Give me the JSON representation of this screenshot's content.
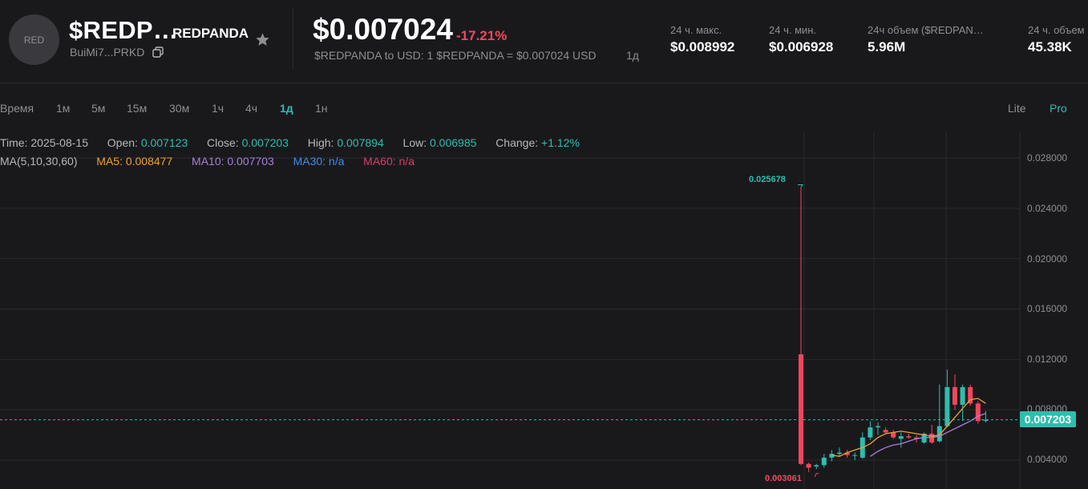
{
  "header": {
    "logo_text": "RED",
    "symbol": "$REDP…",
    "name": "REDPANDA",
    "address": "BuiMi7...PRKD",
    "price": "$0.007024",
    "change": "-17.21%",
    "conversion": "$REDPANDA to USD: 1 $REDPANDA = $0.007024 USD",
    "conversion_interval": "1д",
    "stats": [
      {
        "label": "24 ч. макс.",
        "value": "$0.008992"
      },
      {
        "label": "24 ч. мин.",
        "value": "$0.006928"
      },
      {
        "label": "24ч объем ($REDPAN…",
        "value": "5.96M"
      },
      {
        "label": "24 ч. объем",
        "value": "45.38K"
      }
    ]
  },
  "toolbar": {
    "intervals": [
      "Время",
      "1м",
      "5м",
      "15м",
      "30м",
      "1ч",
      "4ч",
      "1д",
      "1н"
    ],
    "active_interval": "1д",
    "modes": [
      "Lite",
      "Pro"
    ],
    "active_mode": "Pro"
  },
  "ohlc": {
    "time_label": "Time:",
    "time": "2025-08-15",
    "open_label": "Open:",
    "open": "0.007123",
    "close_label": "Close:",
    "close": "0.007203",
    "high_label": "High:",
    "high": "0.007894",
    "low_label": "Low:",
    "low": "0.006985",
    "change_label": "Change:",
    "change": "+1.12%"
  },
  "ma": {
    "label": "MA(5,10,30,60)",
    "ma5": "MA5: 0.008477",
    "ma10": "MA10: 0.007703",
    "ma30": "MA30: n/a",
    "ma60": "MA60: n/a"
  },
  "colors": {
    "up": "#2ebdae",
    "down": "#f6465d",
    "ma5": "#f0a030",
    "ma10": "#a97fd6",
    "ma30": "#3b8fe8",
    "ma60": "#e03a6a"
  },
  "chart_data": {
    "type": "candlestick",
    "y_ticks": [
      "0.028000",
      "0.024000",
      "0.020000",
      "0.016000",
      "0.012000",
      "0.008000",
      "0.004000"
    ],
    "current_price": "0.007203",
    "max_marker": "0.025678",
    "min_marker": "0.003061",
    "ylim": [
      0.0021,
      0.0307
    ],
    "candles": [
      {
        "o": 0.0124,
        "h": 0.02568,
        "l": 0.0036,
        "c": 0.0037
      },
      {
        "o": 0.0037,
        "h": 0.0038,
        "l": 0.00306,
        "c": 0.0034
      },
      {
        "o": 0.0035,
        "h": 0.0037,
        "l": 0.0033,
        "c": 0.0036
      },
      {
        "o": 0.0036,
        "h": 0.0045,
        "l": 0.0034,
        "c": 0.0042
      },
      {
        "o": 0.0042,
        "h": 0.0048,
        "l": 0.0039,
        "c": 0.0045
      },
      {
        "o": 0.0045,
        "h": 0.005,
        "l": 0.0043,
        "c": 0.0046
      },
      {
        "o": 0.0046,
        "h": 0.0048,
        "l": 0.0042,
        "c": 0.0044
      },
      {
        "o": 0.0044,
        "h": 0.0046,
        "l": 0.004,
        "c": 0.0044
      },
      {
        "o": 0.0042,
        "h": 0.0062,
        "l": 0.0041,
        "c": 0.0058
      },
      {
        "o": 0.0058,
        "h": 0.0071,
        "l": 0.0056,
        "c": 0.0066
      },
      {
        "o": 0.0066,
        "h": 0.007,
        "l": 0.006,
        "c": 0.0067
      },
      {
        "o": 0.0064,
        "h": 0.0066,
        "l": 0.0061,
        "c": 0.0062
      },
      {
        "o": 0.0062,
        "h": 0.0064,
        "l": 0.0057,
        "c": 0.0058
      },
      {
        "o": 0.0057,
        "h": 0.0062,
        "l": 0.005,
        "c": 0.0059
      },
      {
        "o": 0.0059,
        "h": 0.0061,
        "l": 0.0057,
        "c": 0.0058
      },
      {
        "o": 0.0058,
        "h": 0.006,
        "l": 0.0054,
        "c": 0.0057
      },
      {
        "o": 0.0054,
        "h": 0.0062,
        "l": 0.0053,
        "c": 0.0061
      },
      {
        "o": 0.0061,
        "h": 0.0068,
        "l": 0.0053,
        "c": 0.0054
      },
      {
        "o": 0.0055,
        "h": 0.01,
        "l": 0.0054,
        "c": 0.0067
      },
      {
        "o": 0.0067,
        "h": 0.0112,
        "l": 0.0066,
        "c": 0.0098
      },
      {
        "o": 0.0098,
        "h": 0.0108,
        "l": 0.008,
        "c": 0.0084
      },
      {
        "o": 0.0084,
        "h": 0.01,
        "l": 0.0071,
        "c": 0.0098
      },
      {
        "o": 0.0098,
        "h": 0.01,
        "l": 0.0083,
        "c": 0.0085
      },
      {
        "o": 0.0085,
        "h": 0.0087,
        "l": 0.0069,
        "c": 0.0071
      },
      {
        "o": 0.00712,
        "h": 0.00789,
        "l": 0.00699,
        "c": 0.0072
      }
    ],
    "ma5": [
      null,
      null,
      null,
      null,
      0.0044,
      0.0043,
      0.0046,
      0.0048,
      0.005,
      0.0053,
      0.0058,
      0.0061,
      0.0062,
      0.0063,
      0.0062,
      0.0061,
      0.006,
      0.0059,
      0.006,
      0.0067,
      0.0074,
      0.0081,
      0.0088,
      0.0089,
      0.0085
    ],
    "ma10": [
      null,
      null,
      null,
      null,
      null,
      null,
      null,
      null,
      null,
      0.0043,
      0.0047,
      0.005,
      0.0052,
      0.0053,
      0.0055,
      0.0057,
      0.0058,
      0.0058,
      0.0059,
      0.0062,
      0.0065,
      0.0068,
      0.0071,
      0.0075,
      0.0077
    ]
  }
}
